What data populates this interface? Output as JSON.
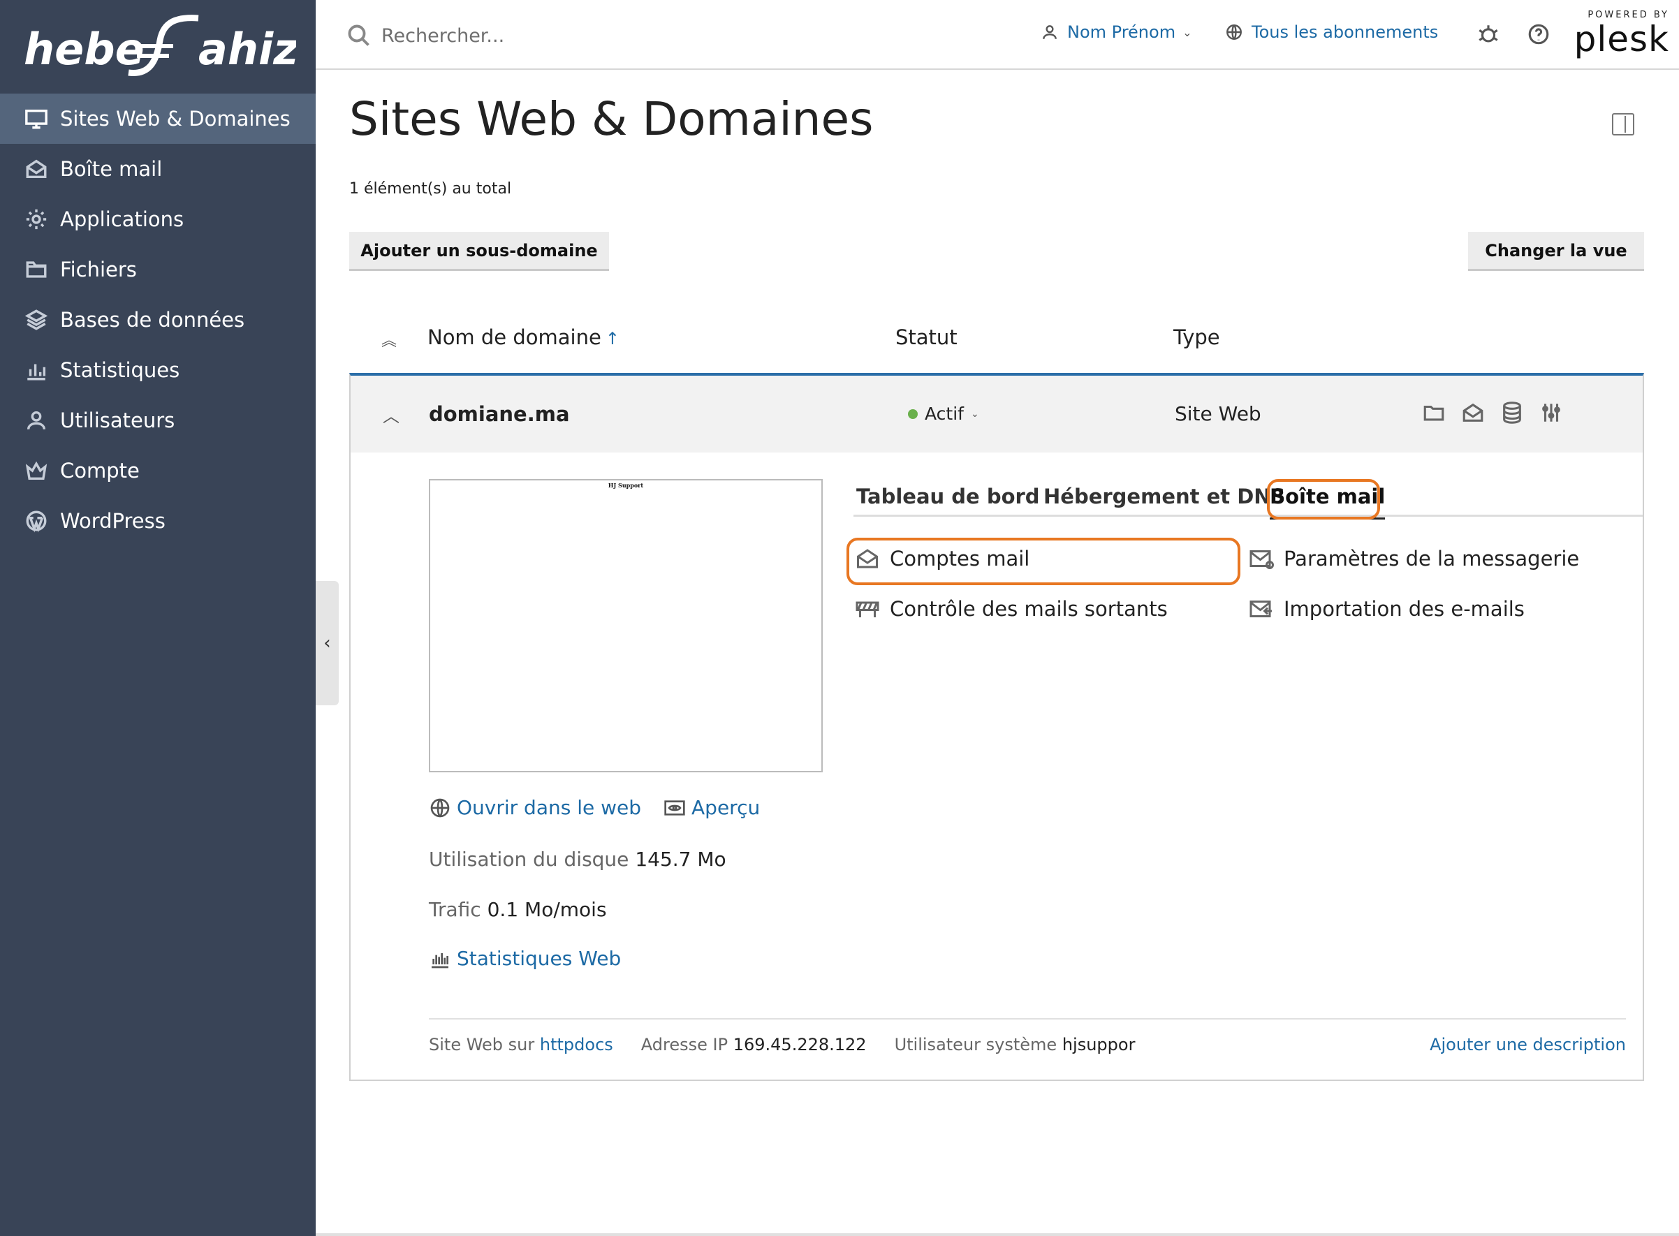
{
  "brand": {
    "logo_text": "hebergement jahiz"
  },
  "sidebar": {
    "items": [
      {
        "label": "Sites Web & Domaines",
        "icon": "monitor-icon",
        "active": true
      },
      {
        "label": "Boîte mail",
        "icon": "mail-icon",
        "active": false
      },
      {
        "label": "Applications",
        "icon": "gear-icon",
        "active": false
      },
      {
        "label": "Fichiers",
        "icon": "folder-icon",
        "active": false
      },
      {
        "label": "Bases de données",
        "icon": "layers-icon",
        "active": false
      },
      {
        "label": "Statistiques",
        "icon": "bar-chart-icon",
        "active": false
      },
      {
        "label": "Utilisateurs",
        "icon": "user-icon",
        "active": false
      },
      {
        "label": "Compte",
        "icon": "crown-icon",
        "active": false
      },
      {
        "label": "WordPress",
        "icon": "wordpress-icon",
        "active": false
      }
    ]
  },
  "header": {
    "search_placeholder": "Rechercher...",
    "user_name": "Nom Prénom",
    "subscriptions": "Tous les abonnements",
    "powered_by": "POWERED BY",
    "plesk": "plesk"
  },
  "page": {
    "title": "Sites Web & Domaines",
    "total": "1 élément(s) au total",
    "add_subdomain": "Ajouter un sous-domaine",
    "change_view": "Changer la vue"
  },
  "table": {
    "col_domain": "Nom de domaine",
    "col_domain_sort": "↑",
    "col_status": "Statut",
    "col_type": "Type"
  },
  "domain": {
    "name": "domiane.ma",
    "status": "Actif",
    "status_color": "#6ab04c",
    "type": "Site Web",
    "preview_title": "HJ Support",
    "open_web": "Ouvrir dans le web",
    "preview_link": "Aperçu",
    "disk_label": "Utilisation du disque",
    "disk_value": "145.7 Mo",
    "traffic_label": "Trafic",
    "traffic_value": "0.1 Mo/mois",
    "web_stats": "Statistiques Web",
    "tabs": [
      "Tableau de bord",
      "Hébergement et DNS",
      "Boîte mail"
    ],
    "active_tab": "Boîte mail",
    "tools": {
      "mail_accounts": "Comptes mail",
      "mail_settings": "Paramètres de la messagerie",
      "outgoing_control": "Contrôle des mails sortants",
      "mail_import": "Importation des e-mails"
    },
    "footer": {
      "site_on": "Site Web sur",
      "site_dir": "httpdocs",
      "ip_label": "Adresse IP",
      "ip_value": "169.45.228.122",
      "sysuser_label": "Utilisateur système",
      "sysuser_value": "hjsuppor",
      "add_description": "Ajouter une description"
    }
  },
  "colors": {
    "sidebar_bg": "#394457",
    "sidebar_active": "#54657c",
    "link": "#1d6aa5",
    "highlight": "#e87722",
    "accent_border": "#2b6ea8"
  }
}
